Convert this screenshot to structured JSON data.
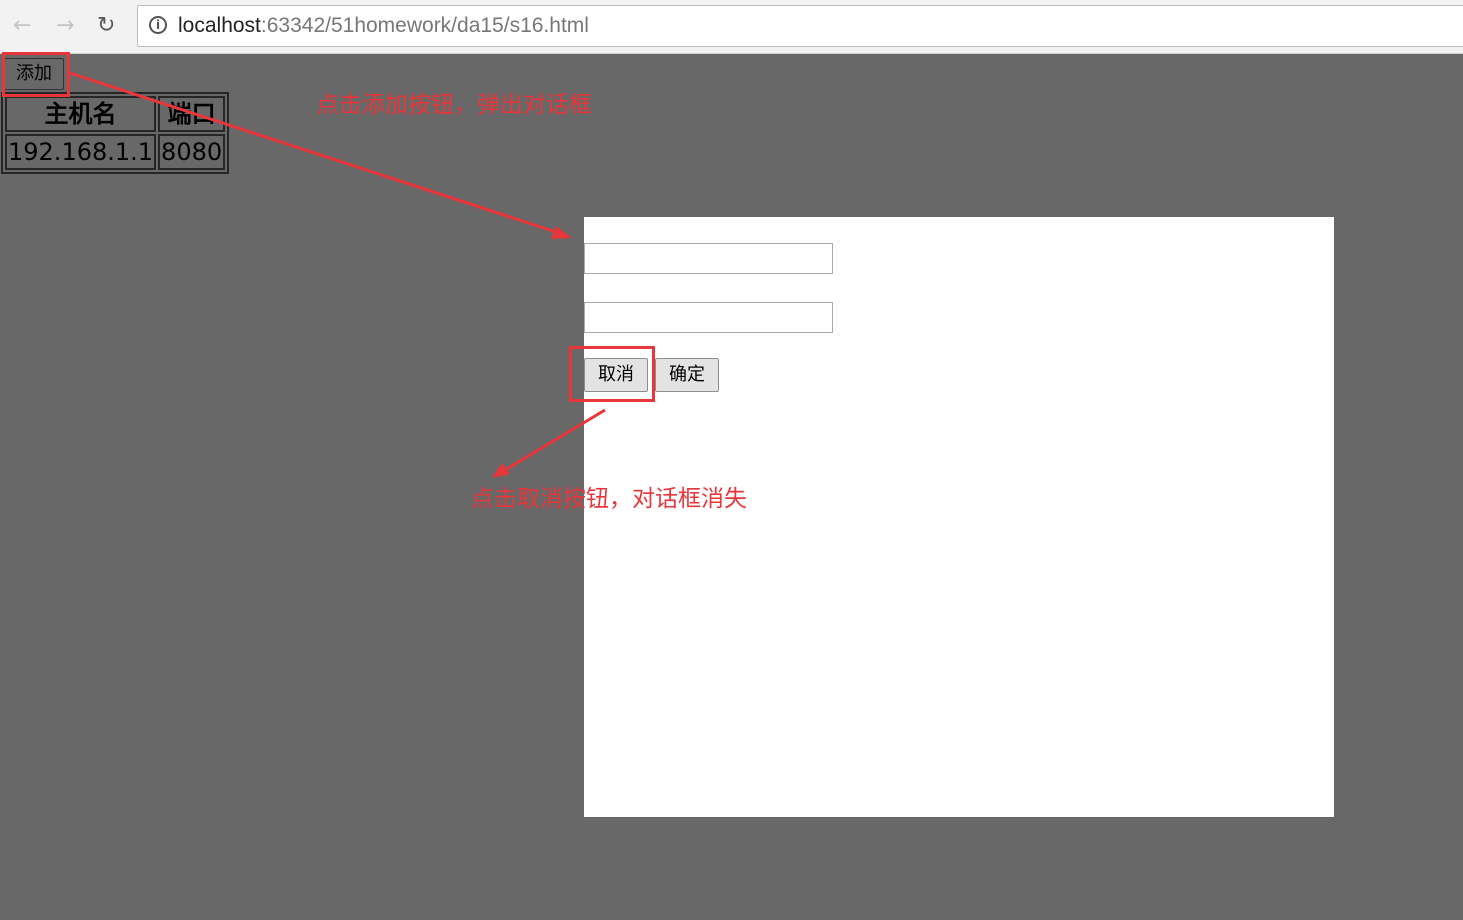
{
  "browser": {
    "nav_back_icon": "arrow-left-icon",
    "nav_forward_icon": "arrow-right-icon",
    "nav_reload_icon": "reload-icon",
    "info_icon": "info-circle-icon",
    "url_host": "localhost",
    "url_rest": ":63342/51homework/da15/s16.html"
  },
  "page": {
    "add_button_label": "添加",
    "table": {
      "headers": [
        "主机名",
        "端口"
      ],
      "rows": [
        [
          "192.168.1.1",
          "8080"
        ]
      ]
    }
  },
  "dialog": {
    "host_input_value": "",
    "port_input_value": "",
    "cancel_label": "取消",
    "ok_label": "确定"
  },
  "annotations": {
    "add_note": "点击添加按钮，弹出对话框",
    "cancel_note": "点击取消按钮，对话框消失",
    "color": "#e8363b"
  },
  "colors": {
    "overlay_background": "#686868",
    "dialog_background": "#ffffff"
  }
}
